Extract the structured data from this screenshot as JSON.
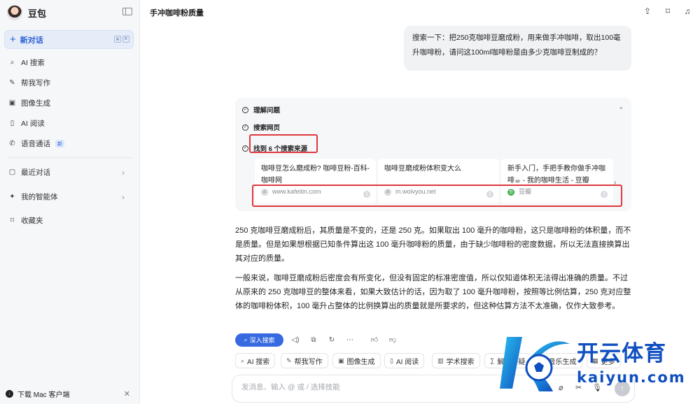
{
  "app": {
    "name": "豆包"
  },
  "sidebar": {
    "new_chat": "新对话",
    "items": [
      {
        "icon": "search-icon",
        "label": "AI 搜索"
      },
      {
        "icon": "pen-icon",
        "label": "帮我写作"
      },
      {
        "icon": "image-icon",
        "label": "图像生成"
      },
      {
        "icon": "reader-icon",
        "label": "AI 阅读"
      },
      {
        "icon": "phone-icon",
        "label": "语音通话",
        "badge": "新"
      }
    ],
    "sections": [
      {
        "icon": "chat-icon",
        "label": "最近对话"
      },
      {
        "icon": "sparkle-icon",
        "label": "我的智能体"
      },
      {
        "icon": "bookmark-icon",
        "label": "收藏夹"
      }
    ],
    "download": "下载 Mac 客户端"
  },
  "header": {
    "title": "手冲咖啡粉质量"
  },
  "user_message": "搜索一下：把250克咖啡豆磨成粉，用来做手冲咖啡，取出100毫升咖啡粉，请问这100ml咖啡粉是由多少克咖啡豆制成的？",
  "search": {
    "steps": [
      "理解问题",
      "搜索网页",
      "找到 6 个搜索来源"
    ],
    "sources": [
      {
        "title": "咖啡豆怎么磨成粉? 咖啡豆粉-百科-咖啡网",
        "site": "www.kafeitin.com",
        "num": "1"
      },
      {
        "title": "咖啡豆磨成粉体积变大么",
        "site": "m.wolvyou.net",
        "num": "2"
      },
      {
        "title": "新手入门，手把手教你做手冲咖啡☕ - 我的咖啡生活 - 豆瓣",
        "site": "豆瓣",
        "num": "3"
      }
    ]
  },
  "answer": {
    "p1": "250 克咖啡豆磨成粉后，其质量是不变的，还是 250 克。如果取出 100 毫升的咖啡粉，这只是咖啡粉的体积量，而不是质量。但是如果想根据已知条件算出这 100 毫升咖啡粉的质量，由于缺少咖啡粉的密度数据，所以无法直接换算出其对应的质量。",
    "p2": "一般来说，咖啡豆磨成粉后密度会有所变化，但没有固定的标准密度值，所以仅知道体积无法得出准确的质量。不过从原来的 250 克咖啡豆的整体来看，如果大致估计的话，因为取了 100 毫升咖啡粉，按照等比例估算，250 克对应整体的咖啡粉体积，100 毫升占整体的比例换算出的质量就是所要求的，但这种估算方法不太准确，仅作大致参考。"
  },
  "actions": {
    "deep_search": "深入搜索"
  },
  "chips": [
    "AI 搜索",
    "帮我写作",
    "图像生成",
    "AI 阅读",
    "学术搜索",
    "解题答疑",
    "音乐生成",
    "更多"
  ],
  "input": {
    "placeholder": "发消息、输入 @ 或 / 选择技能"
  },
  "watermark": {
    "brand": "开云体育",
    "url": "kaiyun.com"
  },
  "colors": {
    "accent": "#3769e0",
    "highlight": "#e0393e",
    "watermark": "#0f4fbf"
  }
}
